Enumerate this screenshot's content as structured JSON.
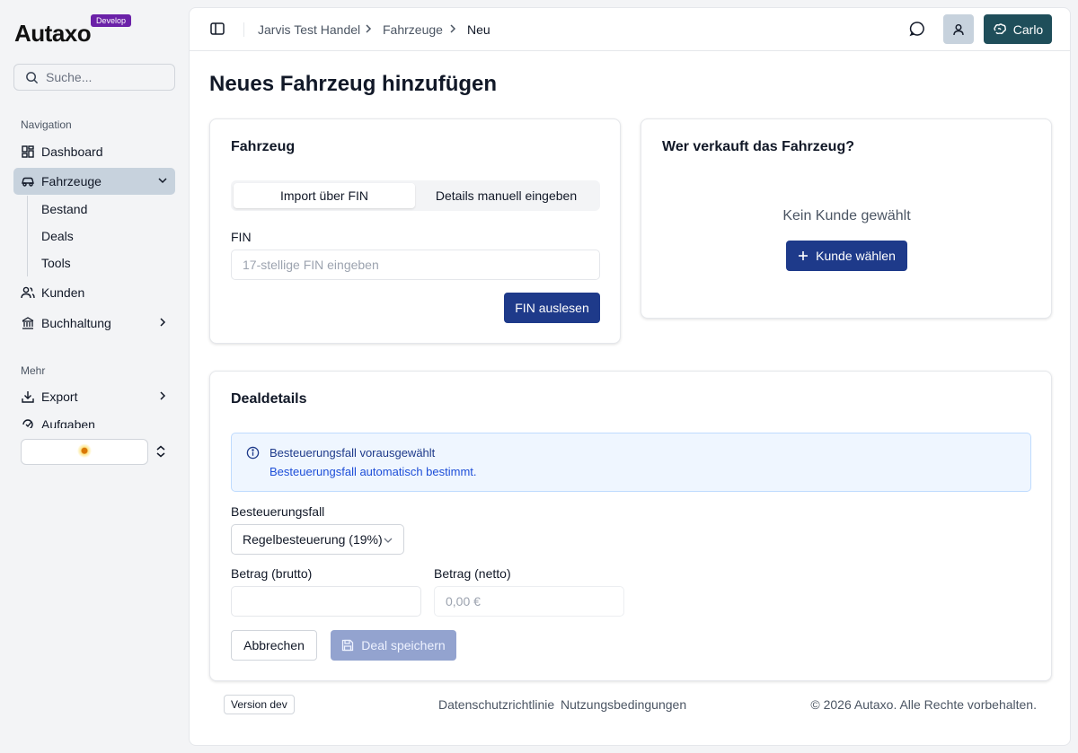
{
  "brand": {
    "name": "Autaxo",
    "env_badge": "Develop",
    "badge_color": "#6b21a8"
  },
  "sidebar": {
    "search_placeholder": "Suche...",
    "nav_label": "Navigation",
    "items": [
      {
        "label": "Dashboard",
        "icon": "dashboard-icon"
      },
      {
        "label": "Fahrzeuge",
        "icon": "car-icon",
        "active": true,
        "expanded": true,
        "children": [
          {
            "label": "Bestand"
          },
          {
            "label": "Deals"
          },
          {
            "label": "Tools"
          }
        ]
      },
      {
        "label": "Kunden",
        "icon": "users-icon"
      },
      {
        "label": "Buchhaltung",
        "icon": "bank-icon"
      }
    ],
    "more_label": "Mehr",
    "more_items": [
      {
        "label": "Export",
        "icon": "download-icon"
      },
      {
        "label": "Aufgaben",
        "icon": "tasks-icon"
      }
    ]
  },
  "topbar": {
    "breadcrumb": [
      "Jarvis Test Handel",
      "Fahrzeuge",
      "Neu"
    ],
    "user_button": "Carlo"
  },
  "page": {
    "title": "Neues Fahrzeug hinzufügen"
  },
  "vehicle_card": {
    "title": "Fahrzeug",
    "tabs": [
      "Import über FIN",
      "Details manuell eingeben"
    ],
    "active_tab": 0,
    "fin_label": "FIN",
    "fin_placeholder": "17-stellige FIN eingeben",
    "fin_button": "FIN auslesen"
  },
  "seller_card": {
    "title": "Wer verkauft das Fahrzeug?",
    "empty_text": "Kein Kunde gewählt",
    "choose_button": "Kunde wählen"
  },
  "deal_card": {
    "title": "Dealdetails",
    "info_title": "Besteuerungsfall vorausgewählt",
    "info_text": "Besteuerungsfall automatisch bestimmt.",
    "tax_label": "Besteuerungsfall",
    "tax_value": "Regelbesteuerung (19%)",
    "gross_label": "Betrag (brutto)",
    "gross_value": "",
    "net_label": "Betrag (netto)",
    "net_placeholder": "0,00 €",
    "cancel_button": "Abbrechen",
    "save_button": "Deal speichern"
  },
  "footer": {
    "version": "Version dev",
    "links": [
      "Datenschutzrichtlinie",
      "Nutzungsbedingungen"
    ],
    "copyright": "© 2026 Autaxo. Alle Rechte vorbehalten."
  },
  "colors": {
    "primary": "#1e3a8a",
    "user_button": "#1f4e5a",
    "active_nav": "#c7d2dd"
  }
}
